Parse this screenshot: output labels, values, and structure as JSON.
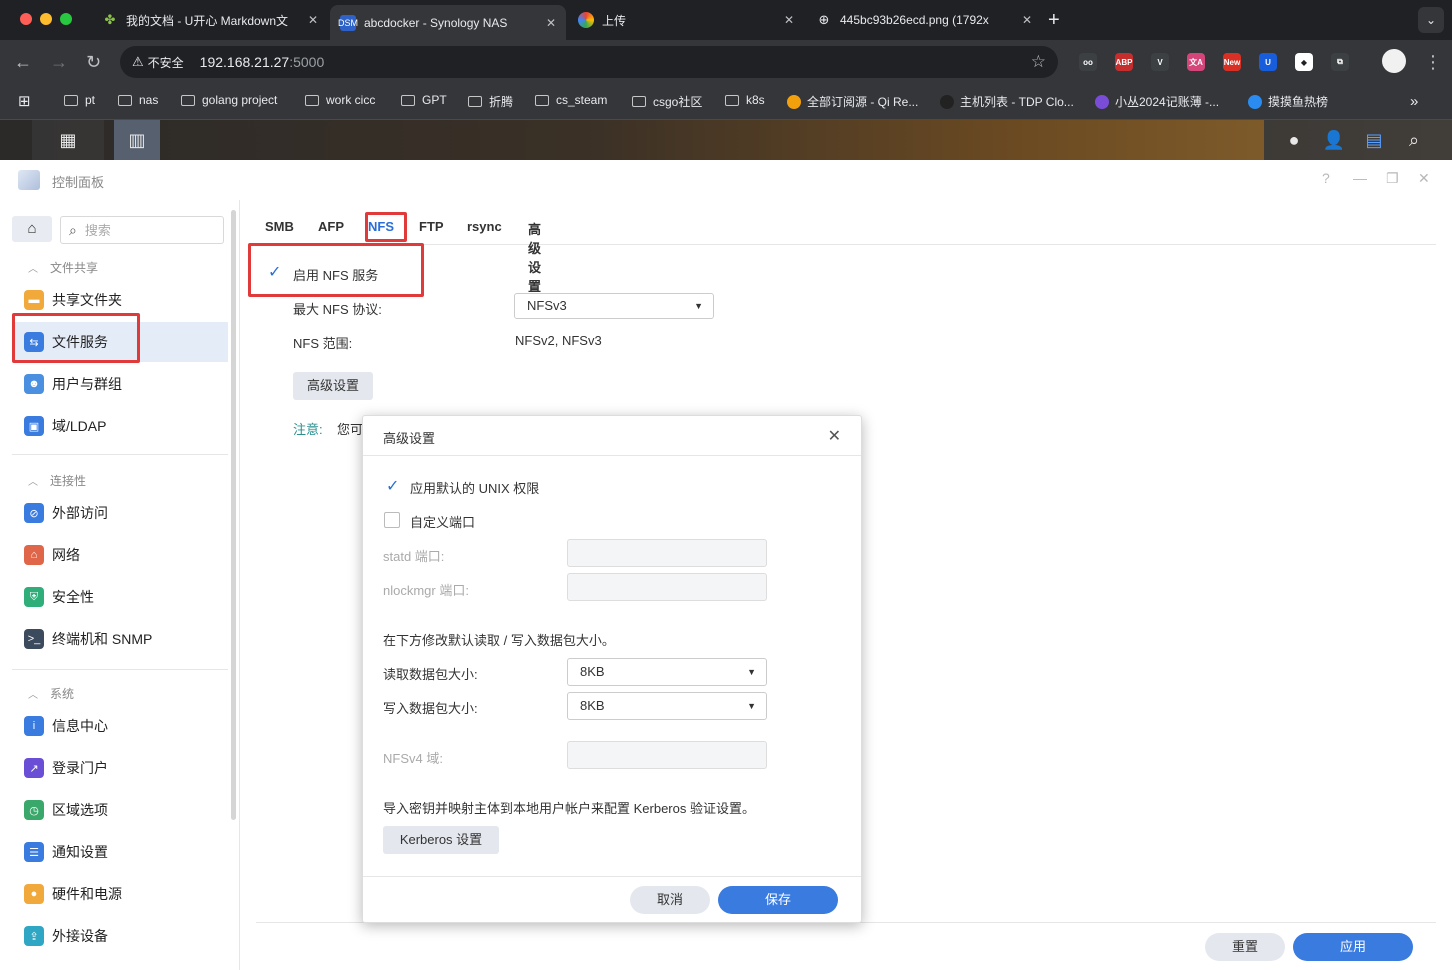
{
  "browser": {
    "tabs": [
      {
        "label": "我的文档 - U开心 Markdown文",
        "icon": "leaf-icon",
        "active": false
      },
      {
        "label": "abcdocker - Synology NAS",
        "icon": "dsm-icon",
        "active": true
      },
      {
        "label": "上传",
        "icon": "pinwheel-icon",
        "active": false
      },
      {
        "label": "445bc93b26ecd.png (1792x",
        "icon": "globe-icon",
        "active": false
      }
    ],
    "security_label": "不安全",
    "url_host": "192.168.21.27",
    "url_port": ":5000",
    "extensions": [
      {
        "name": "glasses-ext-icon",
        "color": "#3c4043",
        "text": "oo"
      },
      {
        "name": "abp-ext-icon",
        "color": "#c62d2d",
        "text": "ABP"
      },
      {
        "name": "vue-ext-icon",
        "color": "#3c4043",
        "text": "V"
      },
      {
        "name": "translate-ext-icon",
        "color": "#d4457a",
        "text": "文A"
      },
      {
        "name": "new-ext-icon",
        "color": "#d93025",
        "text": "New"
      },
      {
        "name": "bitwarden-ext-icon",
        "color": "#175ddc",
        "text": "U"
      },
      {
        "name": "cube-ext-icon",
        "color": "#ffffff",
        "text": "◆"
      },
      {
        "name": "puzzle-ext-icon",
        "color": "#3c4043",
        "text": "⧉"
      }
    ],
    "bookmarks": [
      {
        "label": "pt",
        "type": "folder"
      },
      {
        "label": "nas",
        "type": "folder"
      },
      {
        "label": "golang project",
        "type": "folder"
      },
      {
        "label": "work cicc",
        "type": "folder"
      },
      {
        "label": "GPT",
        "type": "folder"
      },
      {
        "label": "折腾",
        "type": "folder"
      },
      {
        "label": "cs_steam",
        "type": "folder"
      },
      {
        "label": "csgo社区",
        "type": "folder"
      },
      {
        "label": "k8s",
        "type": "folder"
      },
      {
        "label": "全部订阅源 - Qi Re...",
        "type": "site",
        "color": "#f2a10c"
      },
      {
        "label": "主机列表 - TDP Clo...",
        "type": "site",
        "color": "#222222"
      },
      {
        "label": "小丛2024记账薄 -...",
        "type": "site",
        "color": "#7a4dd8"
      },
      {
        "label": "摸摸鱼热榜",
        "type": "site",
        "color": "#2a8cf0"
      }
    ]
  },
  "control_panel": {
    "title": "控制面板",
    "search_placeholder": "搜索",
    "sections": [
      {
        "title": "文件共享",
        "items": [
          {
            "label": "共享文件夹",
            "icon": "shared-folder-icon",
            "color": "#f0a93a"
          },
          {
            "label": "文件服务",
            "icon": "file-services-icon",
            "color": "#3a7be0",
            "selected": true
          },
          {
            "label": "用户与群组",
            "icon": "users-icon",
            "color": "#4a8fe0"
          },
          {
            "label": "域/LDAP",
            "icon": "domain-icon",
            "color": "#3a7be0"
          }
        ]
      },
      {
        "title": "连接性",
        "items": [
          {
            "label": "外部访问",
            "icon": "external-access-icon",
            "color": "#3a7be0"
          },
          {
            "label": "网络",
            "icon": "network-icon",
            "color": "#e0664a"
          },
          {
            "label": "安全性",
            "icon": "security-shield-icon",
            "color": "#2fae7a"
          },
          {
            "label": "终端机和 SNMP",
            "icon": "terminal-icon",
            "color": "#3b4a5c"
          }
        ]
      },
      {
        "title": "系统",
        "items": [
          {
            "label": "信息中心",
            "icon": "info-center-icon",
            "color": "#3a7be0"
          },
          {
            "label": "登录门户",
            "icon": "login-portal-icon",
            "color": "#6a4fd6"
          },
          {
            "label": "区域选项",
            "icon": "regional-options-icon",
            "color": "#3aa86a"
          },
          {
            "label": "通知设置",
            "icon": "notification-icon",
            "color": "#3a7be0"
          },
          {
            "label": "硬件和电源",
            "icon": "hardware-power-icon",
            "color": "#f0a93a"
          },
          {
            "label": "外接设备",
            "icon": "external-devices-icon",
            "color": "#2fa7c4"
          }
        ]
      }
    ],
    "tabs": [
      "SMB",
      "AFP",
      "NFS",
      "FTP",
      "rsync",
      "高级设置"
    ],
    "active_tab": "NFS",
    "nfs": {
      "enable_label": "启用 NFS 服务",
      "enable_checked": true,
      "max_protocol_label": "最大 NFS 协议:",
      "max_protocol_value": "NFSv3",
      "range_label": "NFS 范围:",
      "range_value": "NFSv2, NFSv3",
      "advanced_button": "高级设置",
      "note_label": "注意:",
      "note_text": "您可"
    },
    "reset_button": "重置",
    "apply_button": "应用"
  },
  "dialog": {
    "title": "高级设置",
    "apply_unix_label": "应用默认的 UNIX 权限",
    "apply_unix_checked": true,
    "custom_port_label": "自定义端口",
    "custom_port_checked": false,
    "statd_label": "statd 端口:",
    "nlockmgr_label": "nlockmgr 端口:",
    "packet_note": "在下方修改默认读取 / 写入数据包大小。",
    "read_label": "读取数据包大小:",
    "read_value": "8KB",
    "write_label": "写入数据包大小:",
    "write_value": "8KB",
    "nfsv4_label": "NFSv4 域:",
    "kerberos_note": "导入密钥并映射主体到本地用户帐户来配置 Kerberos 验证设置。",
    "kerberos_button": "Kerberos 设置",
    "cancel_button": "取消",
    "save_button": "保存"
  },
  "colors": {
    "accent": "#3a7be0",
    "highlight_box": "#e03a3a",
    "selected_bg": "#e4ecf8"
  }
}
